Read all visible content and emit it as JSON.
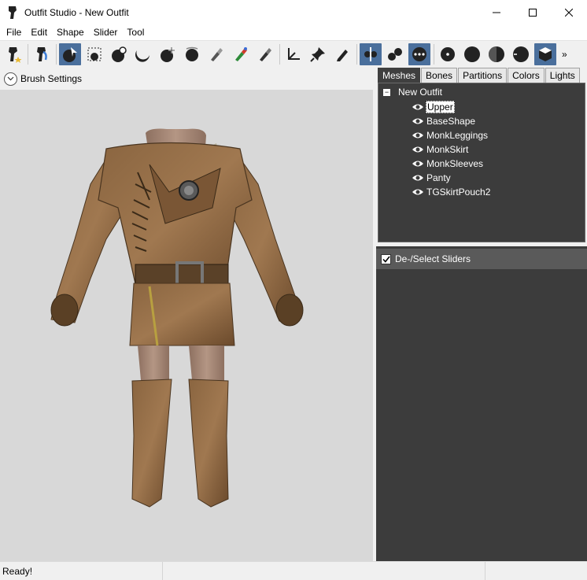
{
  "window": {
    "title": "Outfit Studio - New Outfit",
    "controls": [
      "minimize-icon",
      "maximize-icon",
      "close-icon"
    ]
  },
  "menu": [
    "File",
    "Edit",
    "Shape",
    "Slider",
    "Tool"
  ],
  "toolbar": {
    "tools": [
      {
        "name": "load-reference-icon",
        "active": false
      },
      {
        "name": "load-outfit-icon",
        "active": false
      },
      {
        "name": "select-brush-icon",
        "active": true
      },
      {
        "name": "transform-brush-icon",
        "active": false
      },
      {
        "name": "inflate-brush-icon",
        "active": false
      },
      {
        "name": "deflate-brush-icon",
        "active": false
      },
      {
        "name": "move-brush-icon",
        "active": false
      },
      {
        "name": "smooth-brush-icon",
        "active": false
      },
      {
        "name": "mask-brush-icon",
        "active": false
      },
      {
        "name": "weight-brush-icon",
        "active": false
      },
      {
        "name": "color-brush-icon",
        "active": false
      },
      {
        "name": "axis-icon",
        "active": false
      },
      {
        "name": "pin-icon",
        "active": false
      },
      {
        "name": "edit-icon",
        "active": false
      },
      {
        "name": "mirror-icon",
        "active": true
      },
      {
        "name": "connected-icon",
        "active": false
      },
      {
        "name": "global-brush-icon",
        "active": true
      },
      {
        "name": "point-render-icon",
        "active": false
      },
      {
        "name": "solid-render-icon",
        "active": false
      },
      {
        "name": "shaded-render-icon",
        "active": false
      },
      {
        "name": "smooth-render-icon",
        "active": false
      },
      {
        "name": "cube-render-icon",
        "active": true
      }
    ],
    "overflow": "»"
  },
  "brush_settings": {
    "label": "Brush Settings"
  },
  "tabs": [
    "Meshes",
    "Bones",
    "Partitions",
    "Colors",
    "Lights"
  ],
  "tree": {
    "root": "New Outfit",
    "items": [
      "Upper",
      "BaseShape",
      "MonkLeggings",
      "MonkSkirt",
      "MonkSleeves",
      "Panty",
      "TGSkirtPouch2"
    ],
    "selected": "Upper"
  },
  "sliders": {
    "label": "De-/Select Sliders",
    "checked": true
  },
  "status": {
    "text": "Ready!"
  },
  "colors": {
    "active_tool": "#4a6f9c",
    "panel_dark": "#3c3c3c",
    "viewport_bg": "#d8d8d8"
  }
}
